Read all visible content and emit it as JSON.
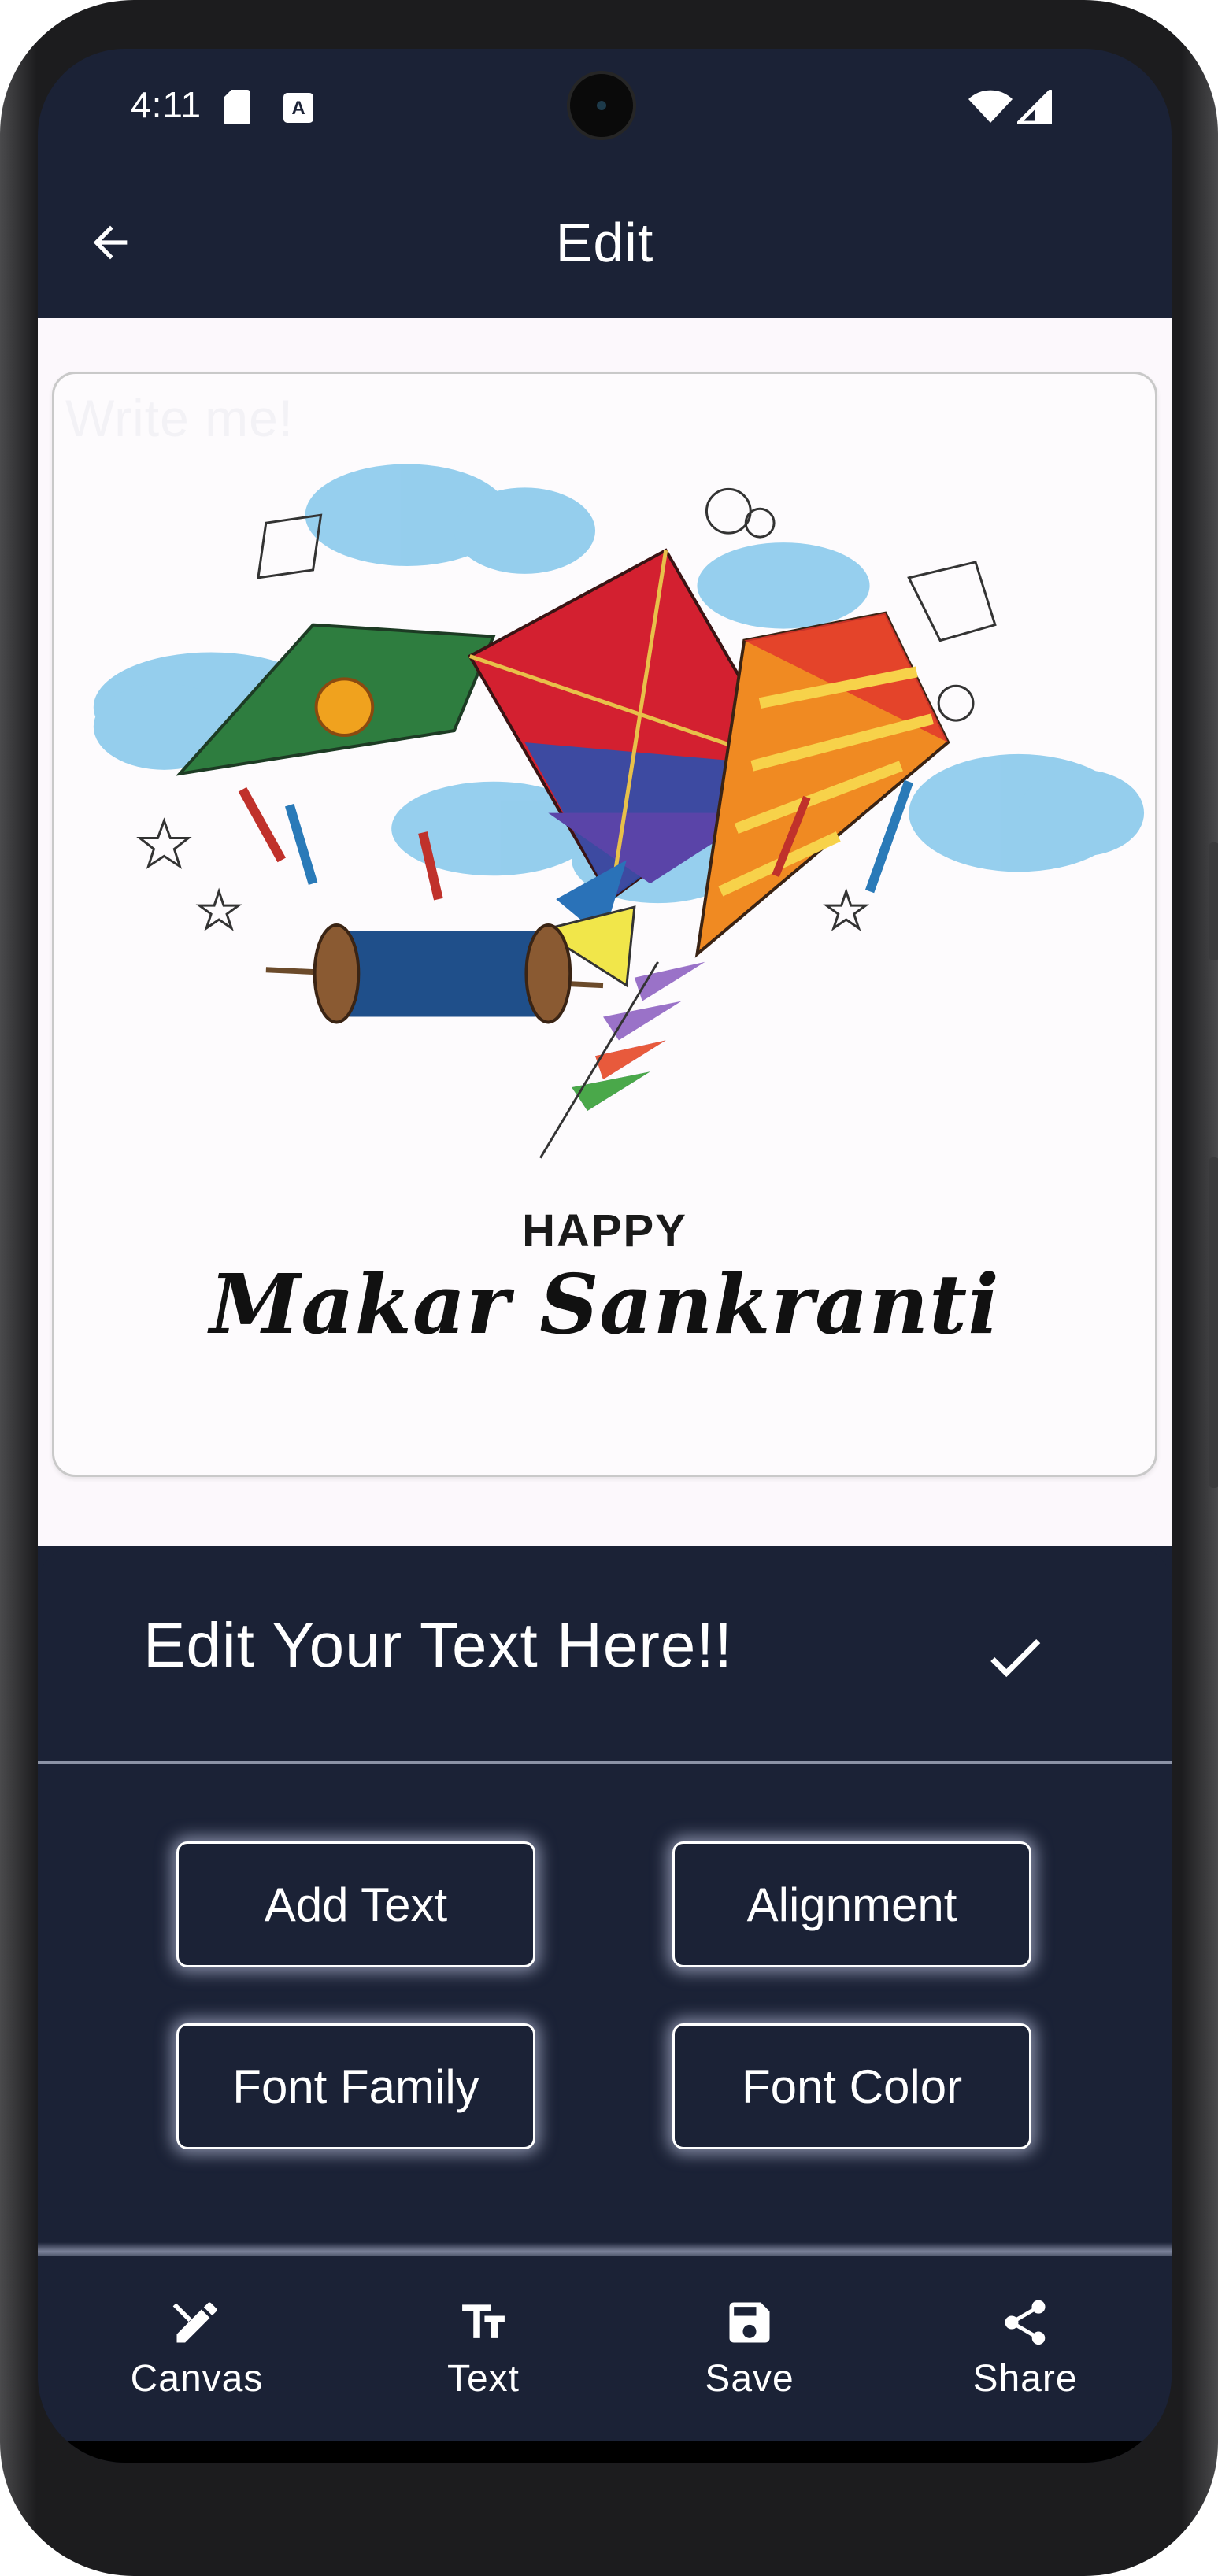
{
  "status_bar": {
    "time": "4:11",
    "icons": [
      "sd-card-icon",
      "a-notification-icon",
      "wifi-icon",
      "signal-icon"
    ]
  },
  "app_bar": {
    "title": "Edit",
    "back_icon": "arrow-back-icon"
  },
  "canvas": {
    "overlay_text": "Write me!",
    "greeting_line1": "HAPPY",
    "greeting_line2": "Makar Sankranti"
  },
  "edit_sheet": {
    "title": "Edit Your Text Here!!",
    "done_icon": "check-icon",
    "options": {
      "add_text": "Add Text",
      "alignment": "Alignment",
      "font_family": "Font Family",
      "font_color": "Font Color"
    }
  },
  "bottom_nav": {
    "canvas": "Canvas",
    "text": "Text",
    "save": "Save",
    "share": "Share"
  },
  "colors": {
    "primary": "#1b2236",
    "on_primary": "#ffffff",
    "background": "#fcf8fc"
  }
}
